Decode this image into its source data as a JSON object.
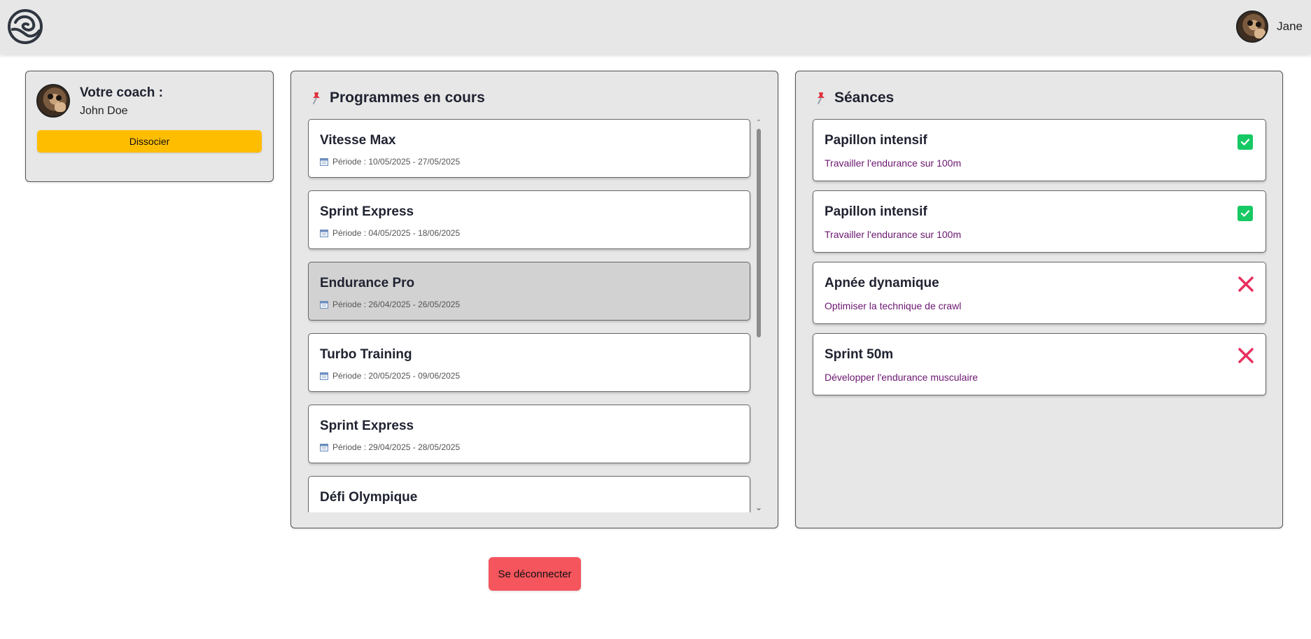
{
  "header": {
    "logo_icon": "swirl-logo-icon",
    "user_name": "Jane"
  },
  "coach": {
    "title": "Votre coach :",
    "name": "John Doe",
    "dissociate_label": "Dissocier"
  },
  "programs": {
    "title": "Programmes en cours",
    "items": [
      {
        "name": "Vitesse Max",
        "period": "Période : 10/05/2025 - 27/05/2025",
        "selected": false
      },
      {
        "name": "Sprint Express",
        "period": "Période : 04/05/2025 - 18/06/2025",
        "selected": false
      },
      {
        "name": "Endurance Pro",
        "period": "Période : 26/04/2025 - 26/05/2025",
        "selected": true
      },
      {
        "name": "Turbo Training",
        "period": "Période : 20/05/2025 - 09/06/2025",
        "selected": false
      },
      {
        "name": "Sprint Express",
        "period": "Période : 29/04/2025 - 28/05/2025",
        "selected": false
      },
      {
        "name": "Défi Olympique",
        "period": "",
        "selected": false
      }
    ]
  },
  "sessions": {
    "title": "Séances",
    "items": [
      {
        "name": "Papillon intensif",
        "description": "Travailler l'endurance sur 100m",
        "status": "done"
      },
      {
        "name": "Papillon intensif",
        "description": "Travailler l'endurance sur 100m",
        "status": "done"
      },
      {
        "name": "Apnée dynamique",
        "description": "Optimiser la technique de crawl",
        "status": "not-done"
      },
      {
        "name": "Sprint 50m",
        "description": "Développer l'endurance musculaire",
        "status": "not-done"
      }
    ]
  },
  "logout_label": "Se déconnecter",
  "colors": {
    "dissociate": "#ffbd00",
    "logout": "#f5555d",
    "done": "#17c964",
    "not_done": "#e8305f",
    "description": "#6b1670"
  }
}
